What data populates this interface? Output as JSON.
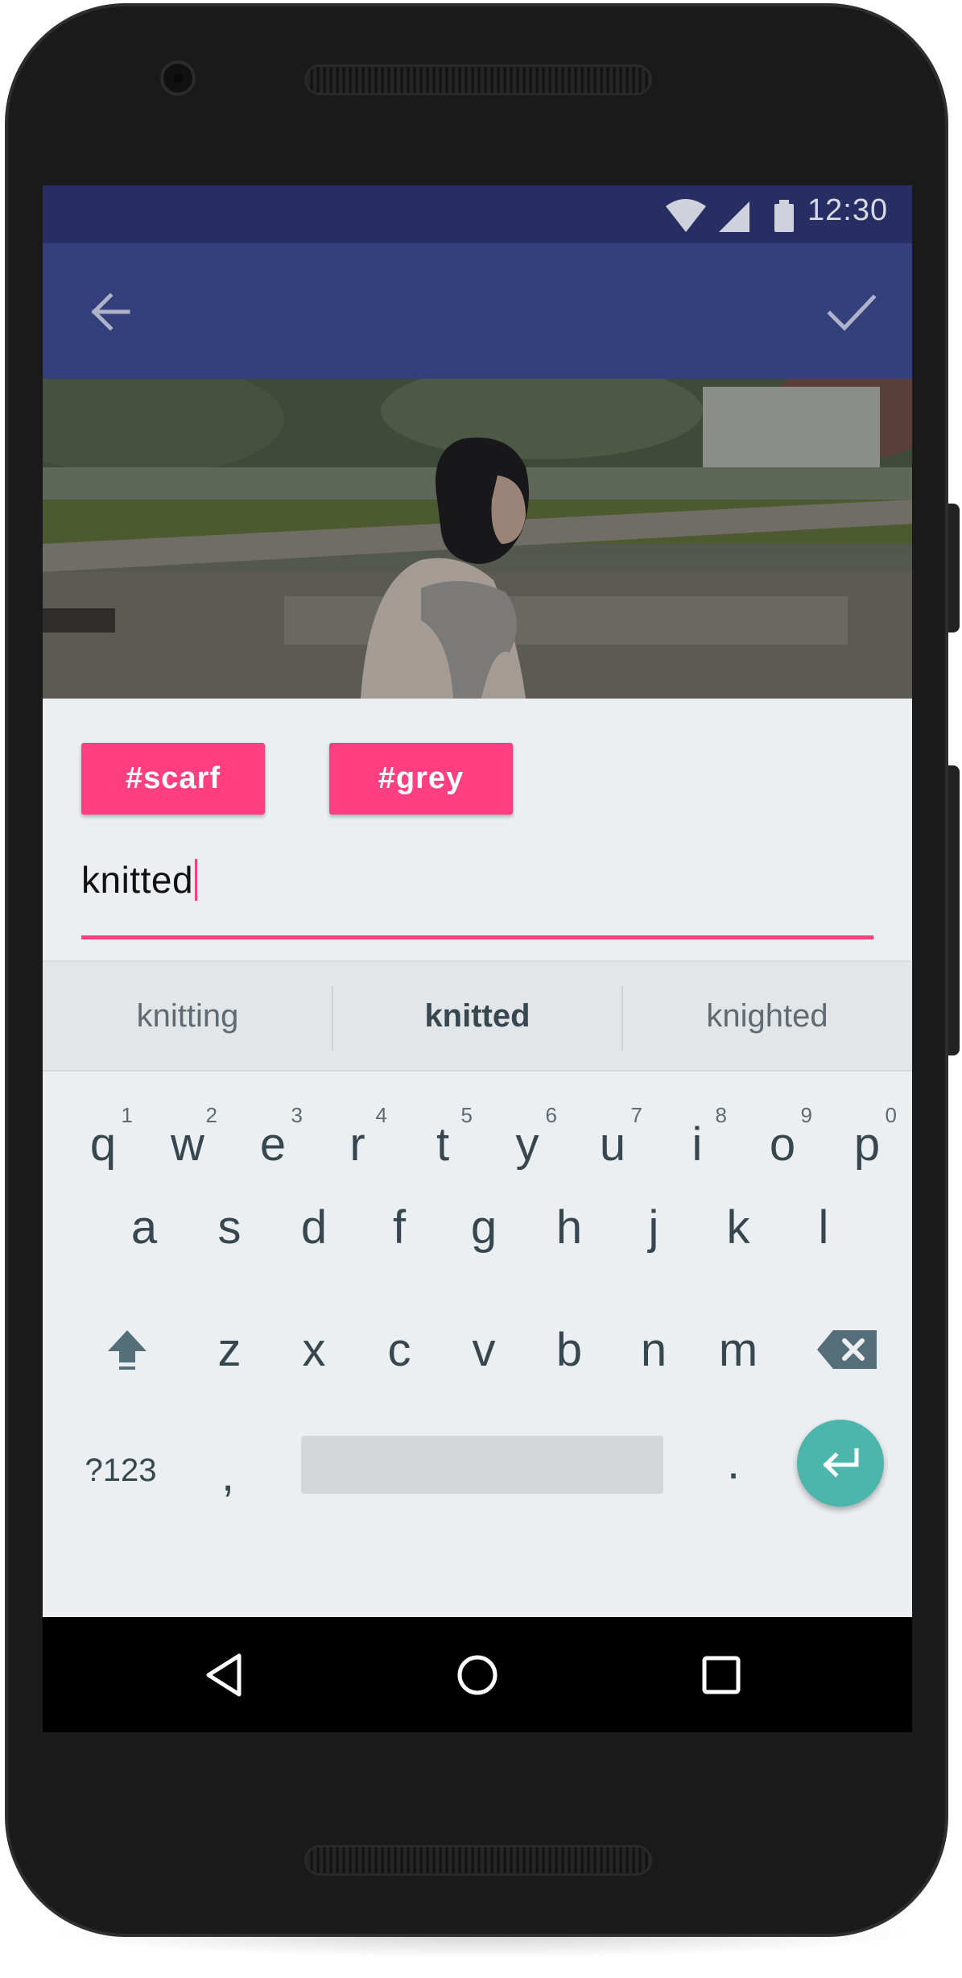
{
  "status_bar": {
    "time": "12:30",
    "icons": [
      "wifi-icon",
      "cell-signal-icon",
      "battery-icon"
    ]
  },
  "toolbar": {
    "back_icon": "arrow-back-icon",
    "confirm_icon": "check-icon"
  },
  "tags": [
    "#scarf",
    "#grey"
  ],
  "input": {
    "value": "knitted"
  },
  "suggestions": [
    "knitting",
    "knitted",
    "knighted"
  ],
  "keyboard": {
    "row1": [
      {
        "k": "q",
        "n": "1"
      },
      {
        "k": "w",
        "n": "2"
      },
      {
        "k": "e",
        "n": "3"
      },
      {
        "k": "r",
        "n": "4"
      },
      {
        "k": "t",
        "n": "5"
      },
      {
        "k": "y",
        "n": "6"
      },
      {
        "k": "u",
        "n": "7"
      },
      {
        "k": "i",
        "n": "8"
      },
      {
        "k": "o",
        "n": "9"
      },
      {
        "k": "p",
        "n": "0"
      }
    ],
    "row2": [
      "a",
      "s",
      "d",
      "f",
      "g",
      "h",
      "j",
      "k",
      "l"
    ],
    "row3": [
      "z",
      "x",
      "c",
      "v",
      "b",
      "n",
      "m"
    ],
    "symbols_label": "?123",
    "comma_label": ",",
    "period_label": "."
  },
  "colors": {
    "primary": "#33407b",
    "primary_dark": "#262e63",
    "accent": "#ff3f80",
    "enter_fab": "#4db6ac"
  }
}
